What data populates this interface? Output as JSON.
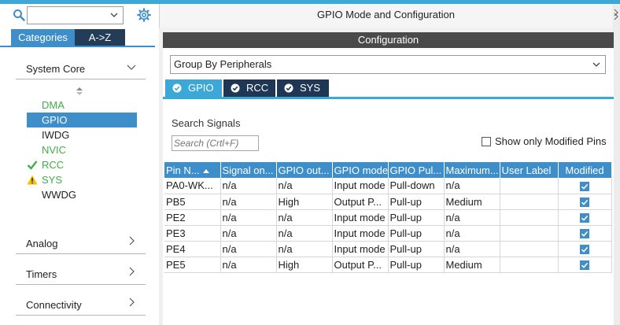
{
  "left_panel": {
    "search_combo_value": "",
    "tabs": {
      "categories": "Categories",
      "az": "A->Z"
    },
    "sections": [
      {
        "label": "System Core",
        "expanded": true
      },
      {
        "label": "Analog",
        "expanded": false
      },
      {
        "label": "Timers",
        "expanded": false
      },
      {
        "label": "Connectivity",
        "expanded": false
      }
    ],
    "system_core_items": [
      {
        "label": "DMA",
        "state": "available"
      },
      {
        "label": "GPIO",
        "state": "selected"
      },
      {
        "label": "IWDG",
        "state": "default"
      },
      {
        "label": "NVIC",
        "state": "available"
      },
      {
        "label": "RCC",
        "state": "configured"
      },
      {
        "label": "SYS",
        "state": "warning"
      },
      {
        "label": "WWDG",
        "state": "default"
      }
    ]
  },
  "right_panel": {
    "header": "GPIO Mode and Configuration",
    "configuration_bar": "Configuration",
    "group_by": "Group By Peripherals",
    "peripheral_tabs": [
      "GPIO",
      "RCC",
      "SYS"
    ],
    "search_signals_label": "Search Signals",
    "search_placeholder": "Search (Crtl+F)",
    "show_modified_label": "Show only Modified Pins",
    "show_modified_checked": false,
    "table": {
      "columns": [
        "Pin N...",
        "Signal on...",
        "GPIO out...",
        "GPIO mode",
        "GPIO Pul...",
        "Maximum...",
        "User Label",
        "Modified"
      ],
      "rows": [
        [
          "PA0-WK...",
          "n/a",
          "n/a",
          "Input mode",
          "Pull-down",
          "n/a",
          "",
          true
        ],
        [
          "PB5",
          "n/a",
          "High",
          "Output P...",
          "Pull-up",
          "Medium",
          "",
          true
        ],
        [
          "PE2",
          "n/a",
          "n/a",
          "Input mode",
          "Pull-up",
          "n/a",
          "",
          true
        ],
        [
          "PE3",
          "n/a",
          "n/a",
          "Input mode",
          "Pull-up",
          "n/a",
          "",
          true
        ],
        [
          "PE4",
          "n/a",
          "n/a",
          "Input mode",
          "Pull-up",
          "n/a",
          "",
          true
        ],
        [
          "PE5",
          "n/a",
          "High",
          "Output P...",
          "Pull-up",
          "Medium",
          "",
          true
        ]
      ]
    }
  },
  "colors": {
    "accent": "#3e8ec9",
    "tab_active": "#3ca8d8",
    "tab_inactive": "#1f3654",
    "available_text": "#3fae49",
    "warning": "#f2c200"
  }
}
